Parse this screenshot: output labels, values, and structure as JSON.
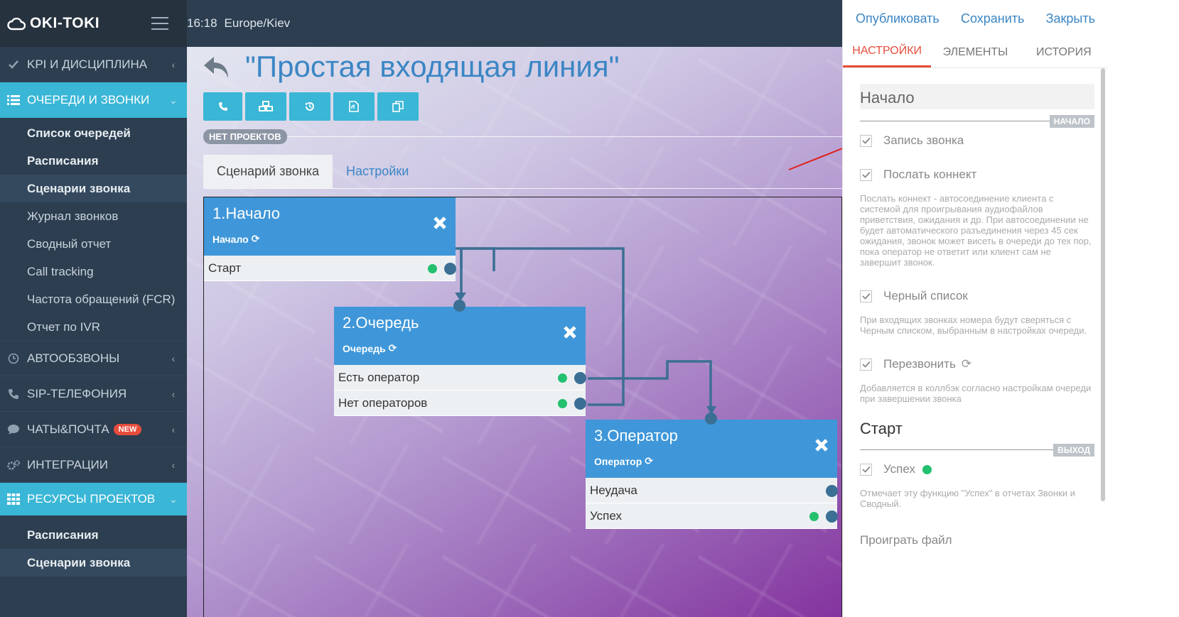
{
  "app": {
    "logo": "OKI-TOKI",
    "time": "16:18",
    "timezone": "Europe/Kiev"
  },
  "sidebar": {
    "sections": [
      {
        "label": "KPI И ДИСЦИПЛИНА",
        "icon": "check-icon",
        "active": false
      },
      {
        "label": "ОЧЕРЕДИ И ЗВОНКИ",
        "icon": "list-icon",
        "active": true,
        "items": [
          "Список очередей",
          "Расписания",
          "Сценарии звонка",
          "Журнал звонков",
          "Сводный отчет",
          "Call tracking",
          "Частота обращений (FCR)",
          "Отчет по IVR"
        ]
      },
      {
        "label": "АВТООБЗВОНЫ",
        "icon": "clock-icon",
        "active": false
      },
      {
        "label": "SIP-ТЕЛЕФОНИЯ",
        "icon": "phone-icon",
        "active": false
      },
      {
        "label": "ЧАТЫ&ПОЧТА",
        "icon": "chat-icon",
        "active": false,
        "badge": "NEW"
      },
      {
        "label": "ИНТЕГРАЦИИ",
        "icon": "gears-icon",
        "active": false
      },
      {
        "label": "РЕСУРСЫ ПРОЕКТОВ",
        "icon": "grid-icon",
        "active": true,
        "items": [
          "Расписания",
          "Сценарии звонка"
        ]
      }
    ]
  },
  "main": {
    "title": "\"Простая входящая линия\"",
    "project_badge": "НЕТ ПРОЕКТОВ",
    "tabs": [
      "Сценарий звонка",
      "Настройки"
    ],
    "nodes": [
      {
        "title": "1.Начало",
        "subtitle": "Начало",
        "rows": [
          "Старт"
        ]
      },
      {
        "title": "2.Очередь",
        "subtitle": "Очередь",
        "rows": [
          "Есть оператор",
          "Нет операторов"
        ]
      },
      {
        "title": "3.Оператор",
        "subtitle": "Оператор",
        "rows": [
          "Неудача",
          "Успех"
        ]
      }
    ]
  },
  "panel": {
    "actions": [
      "Опубликовать",
      "Сохранить",
      "Закрыть"
    ],
    "tabs": [
      "НАСТРОЙКИ",
      "ЭЛЕМЕНТЫ",
      "ИСТОРИЯ"
    ],
    "name_value": "Начало",
    "section_tag": "НАЧАЛО",
    "options": [
      {
        "label": "Запись звонка",
        "help": ""
      },
      {
        "label": "Послать коннект",
        "help": "Послать коннект - автосоединение клиента с системой для проигрывания аудиофайлов приветствия, ожидания и др. При автосоединении не будет автоматического разъединения через 45 сек ожидания, звонок может висеть в очереди до тех пор, пока оператор не ответит или клиент сам не завершит звонок."
      },
      {
        "label": "Черный список",
        "help": "При входящих звонках номера будут сверяться с Черным списком, выбранным в настройках очереди."
      },
      {
        "label": "Перезвонить",
        "help": "Добавляется в коллбэк согласно настройкам очереди при завершении звонка"
      }
    ],
    "exit_heading": "Старт",
    "exit_tag": "ВЫХОД",
    "exit_option": {
      "label": "Успех",
      "help": "Отмечает эту функцию \"Успех\" в отчетах Звонки и Сводный."
    },
    "play_file": "Проиграть файл"
  },
  "colors": {
    "accent": "#3ab6d6",
    "sidebar": "#2c3e50",
    "node": "#3f97d9",
    "danger": "#e74c3c",
    "success": "#22c06f"
  }
}
